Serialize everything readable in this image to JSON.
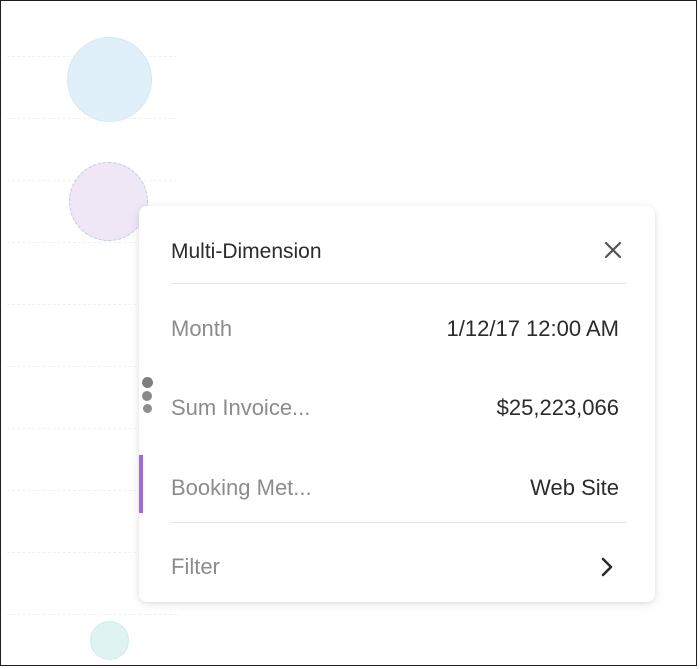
{
  "tooltip": {
    "title": "Multi-Dimension",
    "rows": [
      {
        "label": "Month",
        "value": "1/12/17 12:00 AM"
      },
      {
        "label": "Sum Invoice...",
        "value": "$25,223,066"
      },
      {
        "label": "Booking Met...",
        "value": "Web Site"
      }
    ],
    "filter_label": "Filter",
    "close_icon": "close-icon",
    "filter_icon": "chevron-right-icon",
    "series_color": "#a36bd9"
  },
  "chart_bubbles": [
    {
      "color": "#dff0fa"
    },
    {
      "color": "#efe6f6"
    },
    {
      "color": "#dff3f3"
    }
  ]
}
